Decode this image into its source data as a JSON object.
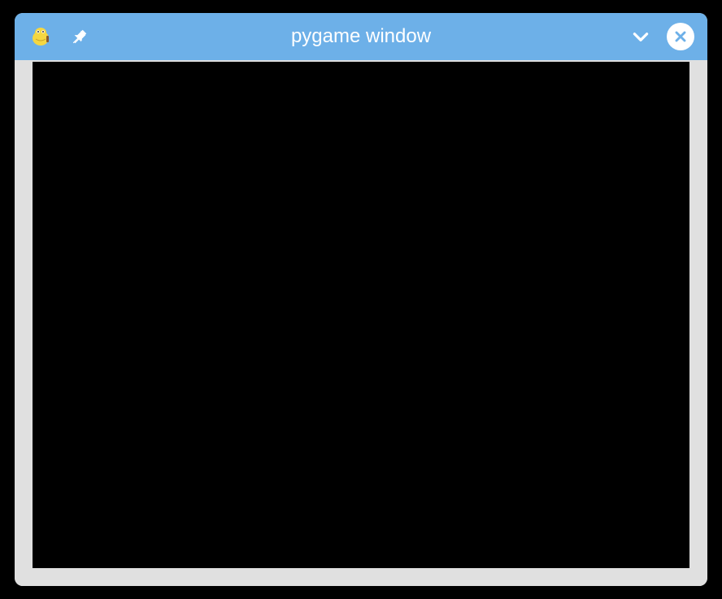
{
  "window": {
    "title": "pygame window"
  },
  "colors": {
    "titlebar": "#6db0e8",
    "chrome": "#e0e0e0",
    "canvas": "#000000"
  }
}
